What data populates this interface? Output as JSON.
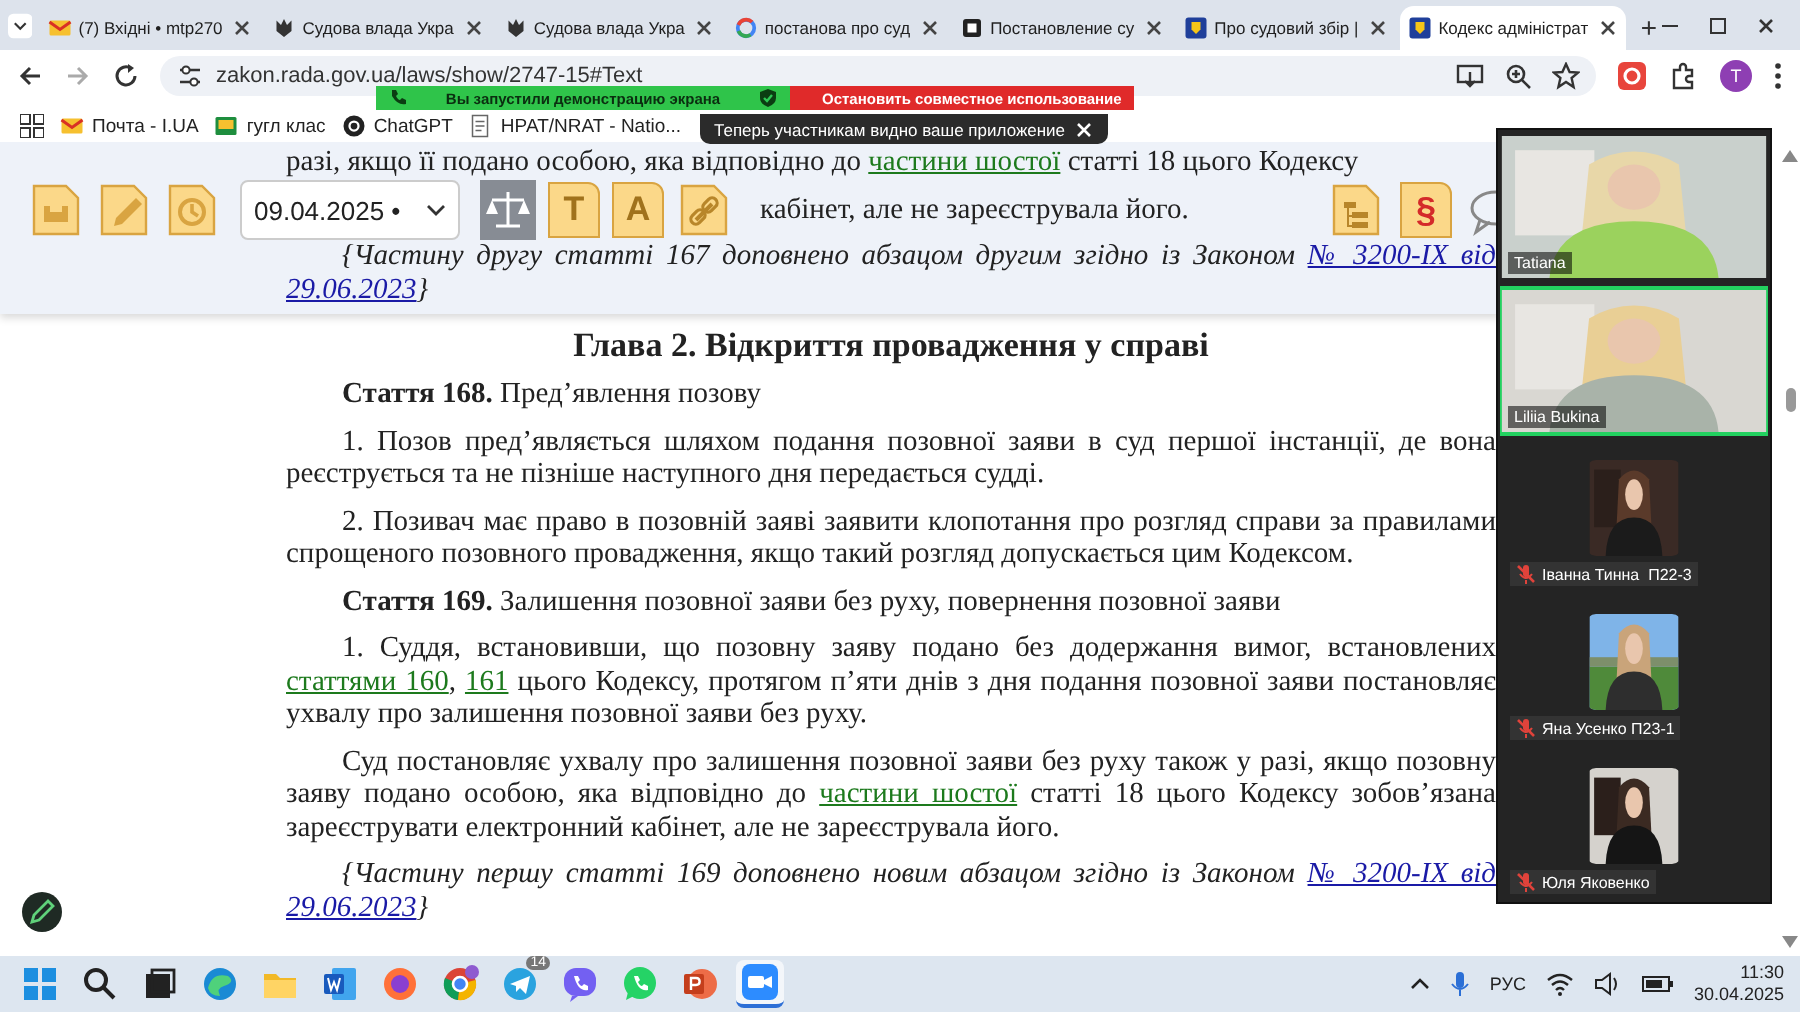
{
  "browser": {
    "tabs": [
      {
        "title": "(7) Вхідні • mtp270",
        "selected": false
      },
      {
        "title": "Судова влада Укра",
        "selected": false
      },
      {
        "title": "Судова влада Укра",
        "selected": false
      },
      {
        "title": "постанова про суд",
        "selected": false
      },
      {
        "title": "Постановление су",
        "selected": false
      },
      {
        "title": "Про судовий збір |",
        "selected": false
      },
      {
        "title": "Кодекс адміністрат",
        "selected": true
      }
    ],
    "url": "zakon.rada.gov.ua/laws/show/2747-15#Text",
    "profile": "T",
    "bookmarks": [
      {
        "label": "Почта - I.UA"
      },
      {
        "label": "гугл клас"
      },
      {
        "label": "ChatGPT"
      },
      {
        "label": "НРАТ/NRAT - Natio..."
      }
    ]
  },
  "share_bar": {
    "status": "Вы запустили демонстрацию экрана",
    "stop_button": "Остановить совместное использование",
    "toast": "Теперь участникам видно ваше приложение"
  },
  "toolbar": {
    "left_tools": [
      {
        "kind": "archive"
      },
      {
        "kind": "edit"
      },
      {
        "kind": "history"
      }
    ],
    "date": "09.04.2025 •",
    "mid_tools": [
      {
        "kind": "scales"
      },
      {
        "kind": "letter",
        "label": "T"
      },
      {
        "kind": "letter",
        "label": "A"
      },
      {
        "kind": "link"
      }
    ],
    "right_tools": [
      {
        "kind": "tree"
      },
      {
        "kind": "section",
        "label": "§"
      },
      {
        "kind": "chat"
      }
    ]
  },
  "document": {
    "lead_line": [
      {
        "kind": "text",
        "text": "разі, якщо її подано особою, яка відповідно до "
      },
      {
        "kind": "ref",
        "text": "частини шостої"
      },
      {
        "kind": "text",
        "text": " статті 18 цього Кодексу"
      }
    ],
    "partial_line": "кабінет, але не зареєструвала його.",
    "blocks": [
      {
        "kind": "note",
        "parts": [
          {
            "kind": "text",
            "text": "{Частину другу статті 167 доповнено абзацом другим згідно із Законом "
          },
          {
            "kind": "law",
            "text": "№ 3200-IX від"
          },
          {
            "kind": "law",
            "text": "29.06.2023"
          },
          {
            "kind": "text",
            "text": "}"
          }
        ]
      },
      {
        "kind": "heading",
        "parts": [
          {
            "kind": "text",
            "text": "Глава 2. Відкриття провадження у справі"
          }
        ]
      },
      {
        "kind": "article",
        "parts": [
          {
            "kind": "text",
            "text": "**Стаття 168.** Пред’явлення позову"
          }
        ]
      },
      {
        "kind": "para",
        "parts": [
          {
            "kind": "text",
            "text": "1. Позов пред’являється шляхом подання позовної заяви в суд першої інстанції, де вона реєструється та не пізніше наступного дня передається судді."
          }
        ]
      },
      {
        "kind": "para",
        "parts": [
          {
            "kind": "text",
            "text": "2. Позивач має право в позовній заяві заявити клопотання про розгляд справи за правилами спрощеного позовного провадження, якщо такий розгляд допускається цим Кодексом."
          }
        ]
      },
      {
        "kind": "article",
        "parts": [
          {
            "kind": "text",
            "text": "**Стаття 169.** Залишення позовної заяви без руху, повернення позовної заяви"
          }
        ]
      },
      {
        "kind": "para",
        "parts": [
          {
            "kind": "text",
            "text": "1. Суддя, встановивши, що позовну заяву подано без додержання вимог, встановлених "
          },
          {
            "kind": "ref",
            "text": "статтями 160"
          },
          {
            "kind": "text",
            "text": ", "
          },
          {
            "kind": "ref",
            "text": "161"
          },
          {
            "kind": "text",
            "text": " цього Кодексу, протягом п’яти днів з дня подання позовної заяви постановляє ухвалу про залишення позовної заяви без руху."
          }
        ]
      },
      {
        "kind": "para",
        "parts": [
          {
            "kind": "text",
            "text": "Суд постановляє ухвалу про залишення позовної заяви без руху також у разі, якщо позовну заяву подано особою, яка відповідно до "
          },
          {
            "kind": "ref",
            "text": "частини шостої"
          },
          {
            "kind": "text",
            "text": " статті 18 цього Кодексу зобов’язана зареєструвати електронний кабінет, але не зареєструвала його."
          }
        ]
      },
      {
        "kind": "note",
        "parts": [
          {
            "kind": "text",
            "text": "{Частину першу статті 169 доповнено новим абзацом згідно із Законом "
          },
          {
            "kind": "law",
            "text": "№ 3200-IX від"
          },
          {
            "kind": "law",
            "text": "29.06.2023"
          },
          {
            "kind": "text",
            "text": "}"
          }
        ]
      }
    ]
  },
  "meeting": {
    "participants": [
      {
        "name": "Tatiana",
        "kind": "video",
        "selected": false,
        "muted": false
      },
      {
        "name": "Liliia Bukina",
        "kind": "video",
        "selected": true,
        "muted": false
      },
      {
        "name": "Іванна Тинна  П22-3",
        "kind": "thumb",
        "selected": false,
        "muted": true
      },
      {
        "name": "Яна Усенко П23-1",
        "kind": "thumb",
        "selected": false,
        "muted": true
      },
      {
        "name": "Юля Яковенко",
        "kind": "thumb",
        "selected": false,
        "muted": true
      }
    ]
  },
  "taskbar": {
    "apps": [
      {
        "kind": "windows",
        "active": false
      },
      {
        "kind": "search",
        "active": false
      },
      {
        "kind": "taskview",
        "active": false
      },
      {
        "kind": "edge",
        "active": false
      },
      {
        "kind": "folder",
        "active": false
      },
      {
        "kind": "word",
        "active": false
      },
      {
        "kind": "firefox",
        "active": false
      },
      {
        "kind": "chrome",
        "active": false
      },
      {
        "kind": "telegram",
        "active": false,
        "badge": "14"
      },
      {
        "kind": "viber",
        "active": false
      },
      {
        "kind": "whatsapp",
        "active": false
      },
      {
        "kind": "powerpoint",
        "active": false
      },
      {
        "kind": "zoom",
        "active": true
      }
    ],
    "language": "РУС",
    "time": "11:30",
    "date": "30.04.2025"
  }
}
